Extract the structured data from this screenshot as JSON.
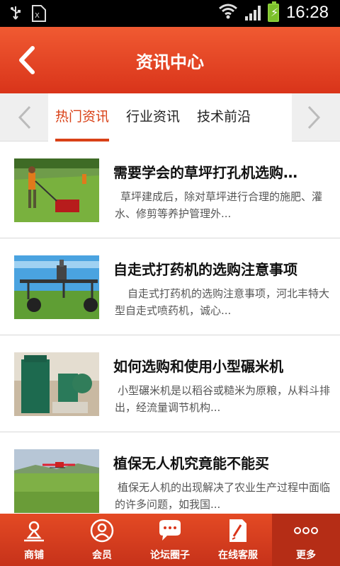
{
  "status_bar": {
    "time": "16:28",
    "icons": [
      "usb-icon",
      "sim-icon",
      "wifi-icon",
      "signal-icon",
      "battery-icon"
    ]
  },
  "header": {
    "title": "资讯中心",
    "back_icon": "chevron-left-icon"
  },
  "tabs": [
    {
      "label": "热门资讯",
      "active": true
    },
    {
      "label": "行业资讯",
      "active": false
    },
    {
      "label": "技术前沿",
      "active": false
    }
  ],
  "articles": [
    {
      "title": "需要学会的草坪打孔机选购…",
      "desc": "草坪建成后，除对草坪进行合理的施肥、灌水、修剪等养护管理外..."
    },
    {
      "title": "自走式打药机的选购注意事项",
      "desc": "自走式打药机的选购注意事项，河北丰特大型自走式喷药机，诚心..."
    },
    {
      "title": "如何选购和使用小型碾米机",
      "desc": "小型碾米机是以稻谷或糙米为原粮，从料斗排出，经流量调节机构..."
    },
    {
      "title": "植保无人机究竟能不能买",
      "desc": "植保无人机的出现解决了农业生产过程中面临的许多问题，如我国..."
    }
  ],
  "bottom_nav": [
    {
      "label": "商铺",
      "icon": "shop-icon"
    },
    {
      "label": "会员",
      "icon": "member-icon"
    },
    {
      "label": "论坛圈子",
      "icon": "forum-icon"
    },
    {
      "label": "在线客服",
      "icon": "service-icon"
    },
    {
      "label": "更多",
      "icon": "more-icon"
    }
  ],
  "colors": {
    "accent": "#d94117",
    "header_top": "#f05a32",
    "header_bottom": "#d9341a"
  }
}
